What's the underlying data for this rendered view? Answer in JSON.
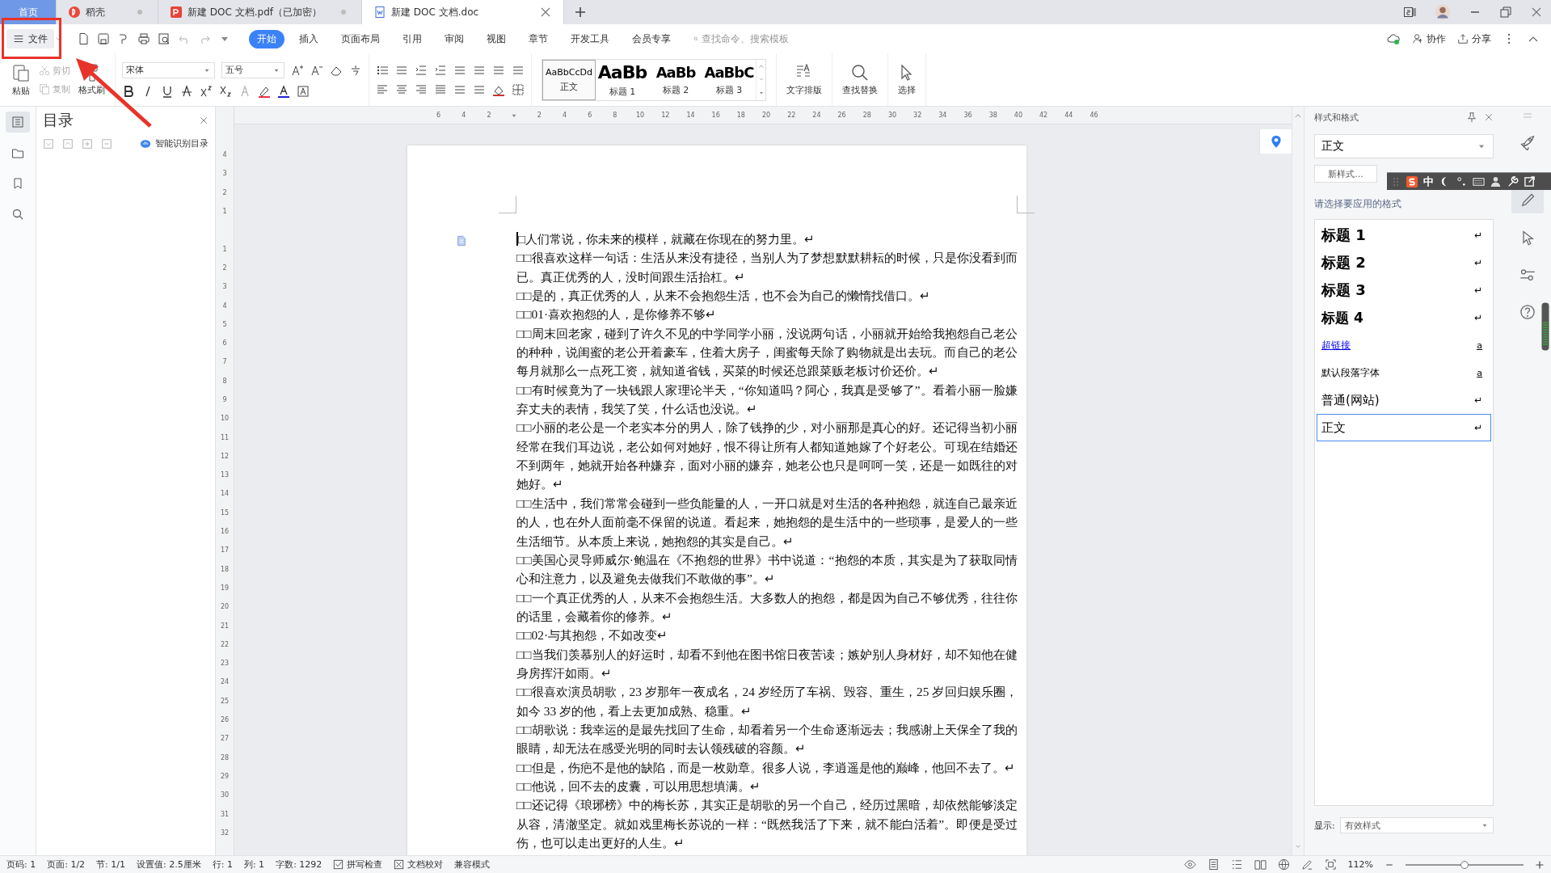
{
  "tabs": [
    {
      "label": "首页",
      "kind": "home",
      "selected": false
    },
    {
      "label": "稻壳",
      "kind": "docer",
      "selected": false
    },
    {
      "label": "新建 DOC 文档.pdf（已加密）",
      "kind": "pdf",
      "selected": false
    },
    {
      "label": "新建 DOC 文档.doc",
      "kind": "doc",
      "selected": true
    }
  ],
  "file_menu": {
    "label": "文件"
  },
  "ribbon_tabs": [
    {
      "label": "开始",
      "selected": true
    },
    {
      "label": "插入",
      "selected": false
    },
    {
      "label": "页面布局",
      "selected": false
    },
    {
      "label": "引用",
      "selected": false
    },
    {
      "label": "审阅",
      "selected": false
    },
    {
      "label": "视图",
      "selected": false
    },
    {
      "label": "章节",
      "selected": false
    },
    {
      "label": "开发工具",
      "selected": false
    },
    {
      "label": "会员专享",
      "selected": false
    }
  ],
  "command_search": {
    "placeholder": "查找命令、搜索模板"
  },
  "header_actions": [
    {
      "label": "协作",
      "kind": "collab"
    },
    {
      "label": "分享",
      "kind": "share"
    }
  ],
  "clipboard": {
    "paste": "粘贴",
    "cut": "剪切",
    "copy": "复制",
    "format_painter": "格式刷"
  },
  "font": {
    "name": "宋体",
    "size": "五号"
  },
  "style_gallery": [
    {
      "sample": "AaBbCcDd",
      "label": "正文",
      "kind": "body",
      "selected": true
    },
    {
      "sample": "AaBb",
      "label": "标题 1",
      "kind": "h1",
      "selected": false
    },
    {
      "sample": "AaBb",
      "label": "标题 2",
      "kind": "h2",
      "selected": false
    },
    {
      "sample": "AaBbC",
      "label": "标题 3",
      "kind": "h3",
      "selected": false
    }
  ],
  "big_tools": [
    {
      "label": "文字排版",
      "kind": "layout"
    },
    {
      "label": "查找替换",
      "kind": "find"
    },
    {
      "label": "选择",
      "kind": "select"
    }
  ],
  "left_tools": [
    {
      "kind": "outline",
      "selected": true
    },
    {
      "kind": "folder",
      "selected": false
    },
    {
      "kind": "bookmark",
      "selected": false
    },
    {
      "kind": "search",
      "selected": false
    }
  ],
  "toc_panel": {
    "title": "目录",
    "smart_toc": "智能识别目录"
  },
  "ruler": {
    "left_of_origin": [
      "6",
      "4",
      "2"
    ],
    "right_of_origin": [
      "2",
      "4",
      "6",
      "8",
      "10",
      "12",
      "14",
      "16",
      "18",
      "20",
      "22",
      "24",
      "26",
      "28",
      "30",
      "32",
      "34",
      "36",
      "38",
      "40",
      "42",
      "44",
      "46"
    ],
    "above_origin": [
      "4",
      "3",
      "2",
      "1"
    ],
    "below_origin": [
      "1",
      "2",
      "3",
      "4",
      "5",
      "6",
      "7",
      "8",
      "9",
      "10",
      "11",
      "12",
      "13",
      "14",
      "15",
      "16",
      "17",
      "18",
      "19",
      "20",
      "21",
      "22",
      "23",
      "24",
      "25",
      "26",
      "27",
      "28",
      "29",
      "30",
      "31",
      "32"
    ]
  },
  "document": {
    "paragraphs": [
      {
        "text": "□人们常说，你未来的模样，就藏在你现在的努力里。↵",
        "has_cursor": true
      },
      {
        "text": "□□很喜欢这样一句话：生活从来没有捷径，当别人为了梦想默默耕耘的时候，只是你没看到而已。真正优秀的人，没时间跟生活抬杠。↵",
        "has_cursor": false
      },
      {
        "text": "□□是的，真正优秀的人，从来不会抱怨生活，也不会为自己的懒惰找借口。↵",
        "has_cursor": false
      },
      {
        "text": "□□01·喜欢抱怨的人，是你修养不够↵",
        "has_cursor": false
      },
      {
        "text": "□□周末回老家，碰到了许久不见的中学同学小丽，没说两句话，小丽就开始给我抱怨自己老公的种种，说闺蜜的老公开着豪车，住着大房子，闺蜜每天除了购物就是出去玩。而自己的老公每月就那么一点死工资，就知道省钱，买菜的时候还总跟菜贩老板讨价还价。↵",
        "has_cursor": false
      },
      {
        "text": "□□有时候竟为了一块钱跟人家理论半天，“你知道吗？阿心，我真是受够了”。看着小丽一脸嫌弃丈夫的表情，我笑了笑，什么话也没说。↵",
        "has_cursor": false
      },
      {
        "text": "□□小丽的老公是一个老实本分的男人，除了钱挣的少，对小丽那是真心的好。还记得当初小丽经常在我们耳边说，老公如何对她好，恨不得让所有人都知道她嫁了个好老公。可现在结婚还不到两年，她就开始各种嫌弃，面对小丽的嫌弃，她老公也只是呵呵一笑，还是一如既往的对她好。↵",
        "has_cursor": false
      },
      {
        "text": "□□生活中，我们常常会碰到一些负能量的人，一开口就是对生活的各种抱怨，就连自己最亲近的人，也在外人面前毫不保留的说道。看起来，她抱怨的是生活中的一些琐事，是爱人的一些生活细节。从本质上来说，她抱怨的其实是自己。↵",
        "has_cursor": false
      },
      {
        "text": "□□美国心灵导师威尔·鲍温在《不抱怨的世界》书中说道：“抱怨的本质，其实是为了获取同情心和注意力，以及避免去做我们不敢做的事”。↵",
        "has_cursor": false
      },
      {
        "text": "□□一个真正优秀的人，从来不会抱怨生活。大多数人的抱怨，都是因为自己不够优秀，往往你的话里，会藏着你的修养。↵",
        "has_cursor": false
      },
      {
        "text": "□□02·与其抱怨，不如改变↵",
        "has_cursor": false
      },
      {
        "text": "□□当我们羡慕别人的好运时，却看不到他在图书馆日夜苦读；嫉妒别人身材好，却不知他在健身房挥汗如雨。↵",
        "has_cursor": false
      },
      {
        "text": "□□很喜欢演员胡歌，23 岁那年一夜成名，24 岁经历了车祸、毁容、重生，25 岁回归娱乐圈，如今 33 岁的他，看上去更加成熟、稳重。↵",
        "has_cursor": false
      },
      {
        "text": "□□胡歌说：我幸运的是最先找回了生命，却看着另一个生命逐渐远去；我感谢上天保全了我的眼睛，却无法在感受光明的同时去认领残破的容颜。↵",
        "has_cursor": false
      },
      {
        "text": "□□但是，伤疤不是他的缺陷，而是一枚勋章。很多人说，李逍遥是他的巅峰，他回不去了。↵",
        "has_cursor": false
      },
      {
        "text": "□□他说，回不去的皮囊，可以用思想填满。↵",
        "has_cursor": false
      },
      {
        "text": "□□还记得《琅琊榜》中的梅长苏，其实正是胡歌的另一个自己，经历过黑暗，却依然能够淡定从容，清澈坚定。就如戏里梅长苏说的一样：“既然我活了下来，就不能白活着”。即便是受过伤，也可以走出更好的人生。↵",
        "has_cursor": false
      }
    ]
  },
  "styles_panel": {
    "title": "样式和格式",
    "current": "正文",
    "new_style": "新样式...",
    "prompt": "请选择要应用的格式",
    "styles": [
      {
        "label": "标题 1",
        "kind": "heading1",
        "mark": "↵",
        "selected": false
      },
      {
        "label": "标题 2",
        "kind": "heading2",
        "mark": "↵",
        "selected": false
      },
      {
        "label": "标题 3",
        "kind": "heading3",
        "mark": "↵",
        "selected": false
      },
      {
        "label": "标题 4",
        "kind": "heading4",
        "mark": "↵",
        "selected": false
      },
      {
        "label": "超链接",
        "kind": "link",
        "mark": "a",
        "selected": false
      },
      {
        "label": "默认段落字体",
        "kind": "plain",
        "mark": "a",
        "selected": false
      },
      {
        "label": "普通(网站)",
        "kind": "normal",
        "mark": "↵",
        "selected": false
      },
      {
        "label": "正文",
        "kind": "normal",
        "mark": "↵",
        "selected": true
      }
    ],
    "show_label": "显示:",
    "show_value": "有效样式"
  },
  "ime_toolbar": {
    "mode": "中"
  },
  "right_tools": [
    {
      "kind": "rocket",
      "selected": false
    },
    {
      "kind": "pen",
      "selected": true
    },
    {
      "kind": "cursor",
      "selected": false
    },
    {
      "kind": "sliders",
      "selected": false
    },
    {
      "kind": "help",
      "selected": false
    }
  ],
  "status_bar": {
    "items": [
      "页码: 1",
      "页面: 1/2",
      "节: 1/1",
      "设置值: 2.5厘米",
      "行: 1",
      "列: 1",
      "字数: 1292"
    ],
    "toggles": [
      {
        "label": "拼写检查",
        "kind": "spell"
      },
      {
        "label": "文档校对",
        "kind": "proof"
      }
    ],
    "mode": "兼容模式",
    "zoom": "112%",
    "zoom_slider": {
      "level": 0.5
    }
  },
  "callout": {
    "kind": "box_arrow"
  }
}
